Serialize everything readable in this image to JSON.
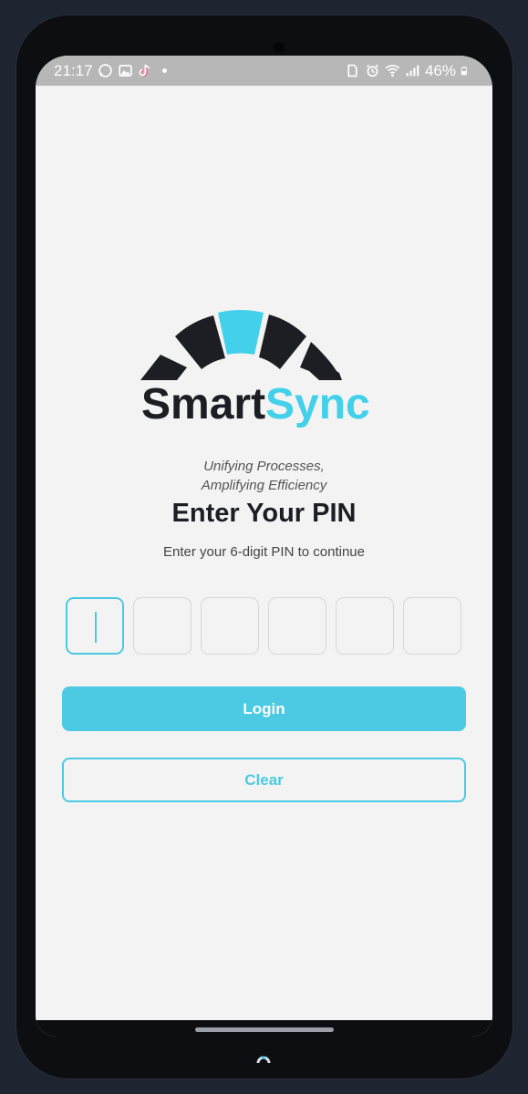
{
  "status_bar": {
    "time": "21:17",
    "battery": "46%",
    "left_icons": [
      "whatsapp-icon",
      "gallery-icon",
      "tiktok-icon"
    ],
    "right_icons": [
      "sim-icon",
      "alarm-icon",
      "wifi-icon",
      "signal-icon",
      "battery-icon"
    ]
  },
  "logo": {
    "text_dark": "Smart",
    "text_accent": "Sync",
    "colors": {
      "dark": "#1c1e24",
      "accent": "#42d0ea"
    }
  },
  "tagline": {
    "line1": "Unifying Processes,",
    "line2": "Amplifying Efficiency"
  },
  "heading": "Enter Your PIN",
  "subheading": "Enter your 6-digit PIN to continue",
  "pin": {
    "length": 6,
    "active_index": 0
  },
  "buttons": {
    "login": "Login",
    "clear": "Clear"
  },
  "colors": {
    "accent": "#4ccae3",
    "background": "#f3f3f3",
    "text": "#1c1e24"
  }
}
